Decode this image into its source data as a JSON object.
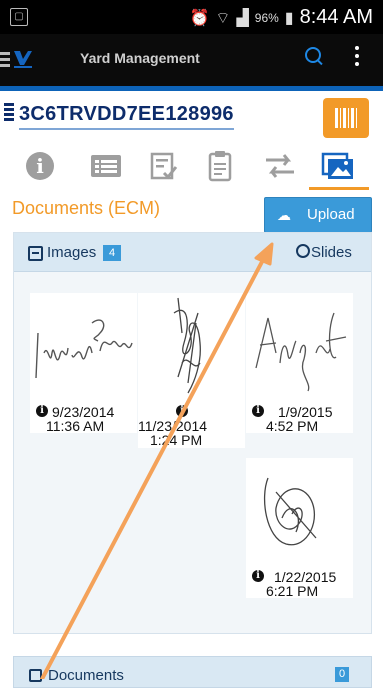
{
  "status_bar": {
    "battery": "96%",
    "time": "8:44 AM"
  },
  "app_bar": {
    "title": "Yard Management"
  },
  "vehicle": {
    "vin": "3C6TRVDD7EE128996"
  },
  "tabs": [
    "info",
    "list",
    "checklist",
    "clipboard",
    "transfer",
    "images"
  ],
  "section": {
    "title": "Documents (ECM)",
    "upload_label": "Upload"
  },
  "images_panel": {
    "label": "Images",
    "count": "4",
    "slides_label": "Slides",
    "items": [
      {
        "date": "9/23/2014",
        "time": "11:36   AM"
      },
      {
        "date": "11/23/2014",
        "time": "1:24   PM"
      },
      {
        "date": "1/9/2015",
        "time": "4:52   PM"
      },
      {
        "date": "1/22/2015",
        "time": "6:21   PM"
      }
    ]
  },
  "documents_panel": {
    "label": "Documents",
    "count": "0"
  },
  "colors": {
    "accent": "#f29a28",
    "primary": "#0d63b8",
    "upload": "#3a9ad9",
    "arrow": "#f4a25a"
  }
}
